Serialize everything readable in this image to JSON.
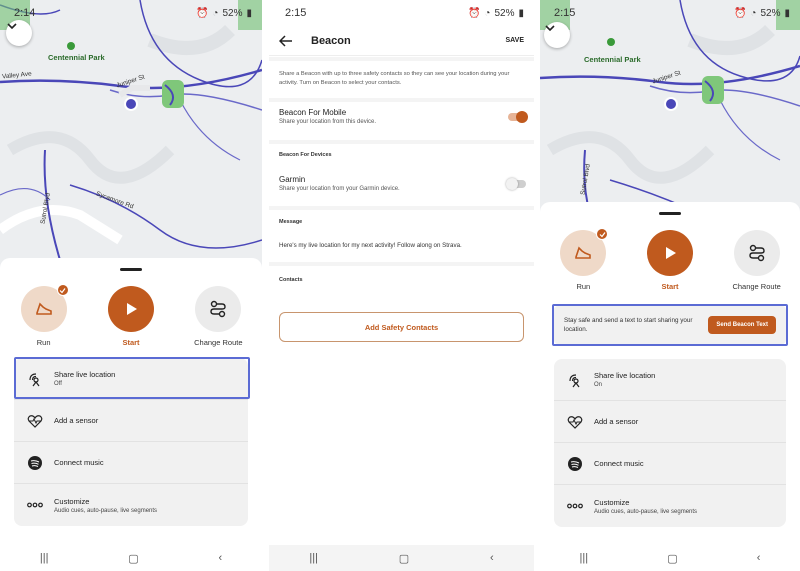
{
  "colors": {
    "accent": "#c05a1e",
    "highlight": "#5b6bd4",
    "route": "#4a47b8",
    "park": "#6fc06f"
  },
  "screen1": {
    "status": {
      "time": "2:14",
      "battery": "52%"
    },
    "map": {
      "park": "Centennial Park",
      "labels": [
        "Valley Ave",
        "Juniper St",
        "Sutrol Blvd",
        "Sycamore Rd"
      ]
    },
    "actions": [
      {
        "label": "Run",
        "icon": "shoe-icon"
      },
      {
        "label": "Start",
        "icon": "play-icon"
      },
      {
        "label": "Change Route",
        "icon": "route-icon"
      }
    ],
    "menu": [
      {
        "title": "Share live location",
        "sub": "Off",
        "icon": "live-location-icon"
      },
      {
        "title": "Add a sensor",
        "sub": "",
        "icon": "heart-pulse-icon"
      },
      {
        "title": "Connect music",
        "sub": "",
        "icon": "spotify-icon"
      },
      {
        "title": "Customize",
        "sub": "Audio cues, auto-pause, live segments",
        "icon": "more-icon"
      }
    ]
  },
  "screen2": {
    "status": {
      "time": "2:15",
      "battery": "52%"
    },
    "title": "Beacon",
    "save": "SAVE",
    "description": "Share a Beacon with up to three safety contacts so they can see your location during your activity. Turn on Beacon to select your contacts.",
    "mobile": {
      "title": "Beacon For Mobile",
      "sub": "Share your location from this device.",
      "on": true
    },
    "devices_header": "Beacon For Devices",
    "garmin": {
      "title": "Garmin",
      "sub": "Share your location from your Garmin device.",
      "on": false
    },
    "message_header": "Message",
    "message": "Here's my live location for my next activity! Follow along on Strava.",
    "contacts_header": "Contacts",
    "add_contacts": "Add Safety Contacts"
  },
  "screen3": {
    "status": {
      "time": "2:15",
      "battery": "52%"
    },
    "map": {
      "park": "Centennial Park",
      "labels": [
        "Juniper St",
        "Sutrol Blvd"
      ]
    },
    "actions": [
      {
        "label": "Run",
        "icon": "shoe-icon"
      },
      {
        "label": "Start",
        "icon": "play-icon"
      },
      {
        "label": "Change Route",
        "icon": "route-icon"
      }
    ],
    "banner": {
      "text": "Stay safe and send a text to start sharing your location.",
      "button": "Send Beacon Text"
    },
    "menu": [
      {
        "title": "Share live location",
        "sub": "On",
        "icon": "live-location-icon"
      },
      {
        "title": "Add a sensor",
        "sub": "",
        "icon": "heart-pulse-icon"
      },
      {
        "title": "Connect music",
        "sub": "",
        "icon": "spotify-icon"
      },
      {
        "title": "Customize",
        "sub": "Audio cues, auto-pause, live segments",
        "icon": "more-icon"
      }
    ]
  }
}
